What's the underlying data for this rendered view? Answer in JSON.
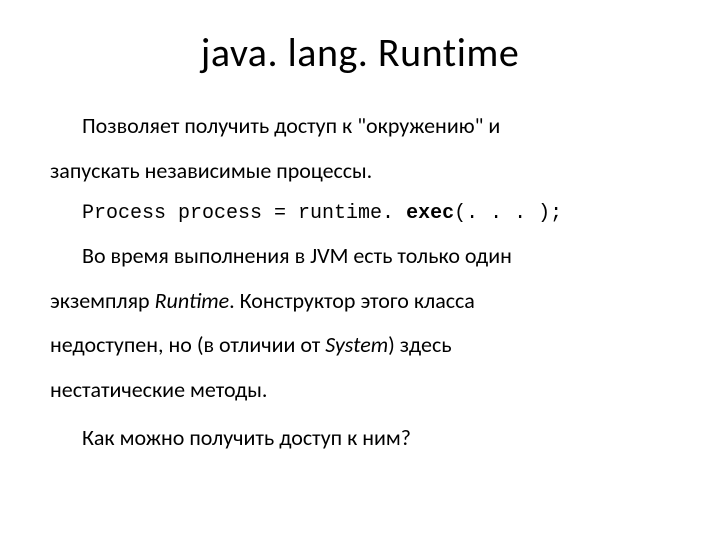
{
  "title": "java. lang. Runtime",
  "p1a": "Позволяет получить доступ к \"окружению\" и",
  "p1b": "запускать независимые процессы.",
  "code_pre": "Process process = runtime. ",
  "code_bold": "exec",
  "code_post": "(. . . );",
  "p2a_pre": "Во время выполнения в JVM есть только один",
  "p2b_pre": "экземпляр ",
  "p2b_em": "Runtime",
  "p2b_post": ". Конструктор этого класса",
  "p2c_pre": "недоступен, но (в отличии от ",
  "p2c_em": "System",
  "p2c_post": ") здесь",
  "p2d": "нестатические методы.",
  "p3": "Как можно получить доступ к ним?"
}
